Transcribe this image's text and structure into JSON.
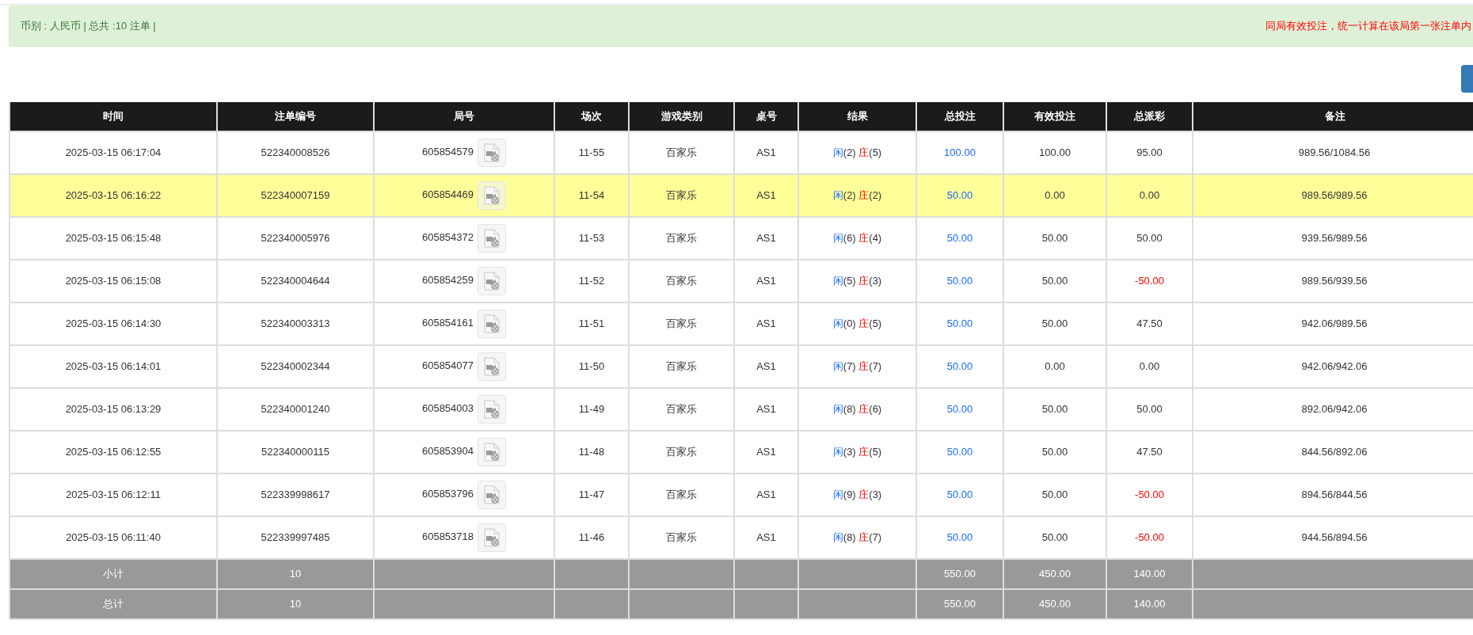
{
  "summary": {
    "text": "币别 : 人民币 | 总共 :10 注单 |",
    "notice": "同局有效投注，统一计算在该局第一张注单内"
  },
  "table": {
    "columns": [
      "时间",
      "注单编号",
      "局号",
      "场次",
      "游戏类别",
      "桌号",
      "结果",
      "总投注",
      "有效投注",
      "总派彩",
      "备注"
    ],
    "rows": [
      {
        "time": "2025-03-15 06:17:04",
        "bet_no": "522340008526",
        "round": "605854579",
        "session": "11-55",
        "game": "百家乐",
        "desk": "AS1",
        "result": {
          "player": "闲",
          "player_points": "(2)",
          "banker": "庄",
          "banker_points": "(5)"
        },
        "total_bet": "100.00",
        "valid_bet": "100.00",
        "payout": "95.00",
        "payout_loss": false,
        "note": "989.56/1084.56",
        "highlighted": false
      },
      {
        "time": "2025-03-15 06:16:22",
        "bet_no": "522340007159",
        "round": "605854469",
        "session": "11-54",
        "game": "百家乐",
        "desk": "AS1",
        "result": {
          "player": "闲",
          "player_points": "(2)",
          "banker": "庄",
          "banker_points": "(2)"
        },
        "total_bet": "50.00",
        "valid_bet": "0.00",
        "payout": "0.00",
        "payout_loss": false,
        "note": "989.56/989.56",
        "highlighted": true
      },
      {
        "time": "2025-03-15 06:15:48",
        "bet_no": "522340005976",
        "round": "605854372",
        "session": "11-53",
        "game": "百家乐",
        "desk": "AS1",
        "result": {
          "player": "闲",
          "player_points": "(6)",
          "banker": "庄",
          "banker_points": "(4)"
        },
        "total_bet": "50.00",
        "valid_bet": "50.00",
        "payout": "50.00",
        "payout_loss": false,
        "note": "939.56/989.56",
        "highlighted": false
      },
      {
        "time": "2025-03-15 06:15:08",
        "bet_no": "522340004644",
        "round": "605854259",
        "session": "11-52",
        "game": "百家乐",
        "desk": "AS1",
        "result": {
          "player": "闲",
          "player_points": "(5)",
          "banker": "庄",
          "banker_points": "(3)"
        },
        "total_bet": "50.00",
        "valid_bet": "50.00",
        "payout": "-50.00",
        "payout_loss": true,
        "note": "989.56/939.56",
        "highlighted": false
      },
      {
        "time": "2025-03-15 06:14:30",
        "bet_no": "522340003313",
        "round": "605854161",
        "session": "11-51",
        "game": "百家乐",
        "desk": "AS1",
        "result": {
          "player": "闲",
          "player_points": "(0)",
          "banker": "庄",
          "banker_points": "(5)"
        },
        "total_bet": "50.00",
        "valid_bet": "50.00",
        "payout": "47.50",
        "payout_loss": false,
        "note": "942.06/989.56",
        "highlighted": false
      },
      {
        "time": "2025-03-15 06:14:01",
        "bet_no": "522340002344",
        "round": "605854077",
        "session": "11-50",
        "game": "百家乐",
        "desk": "AS1",
        "result": {
          "player": "闲",
          "player_points": "(7)",
          "banker": "庄",
          "banker_points": "(7)"
        },
        "total_bet": "50.00",
        "valid_bet": "0.00",
        "payout": "0.00",
        "payout_loss": false,
        "note": "942.06/942.06",
        "highlighted": false
      },
      {
        "time": "2025-03-15 06:13:29",
        "bet_no": "522340001240",
        "round": "605854003",
        "session": "11-49",
        "game": "百家乐",
        "desk": "AS1",
        "result": {
          "player": "闲",
          "player_points": "(8)",
          "banker": "庄",
          "banker_points": "(6)"
        },
        "total_bet": "50.00",
        "valid_bet": "50.00",
        "payout": "50.00",
        "payout_loss": false,
        "note": "892.06/942.06",
        "highlighted": false
      },
      {
        "time": "2025-03-15 06:12:55",
        "bet_no": "522340000115",
        "round": "605853904",
        "session": "11-48",
        "game": "百家乐",
        "desk": "AS1",
        "result": {
          "player": "闲",
          "player_points": "(3)",
          "banker": "庄",
          "banker_points": "(5)"
        },
        "total_bet": "50.00",
        "valid_bet": "50.00",
        "payout": "47.50",
        "payout_loss": false,
        "note": "844.56/892.06",
        "highlighted": false
      },
      {
        "time": "2025-03-15 06:12:11",
        "bet_no": "522339998617",
        "round": "605853796",
        "session": "11-47",
        "game": "百家乐",
        "desk": "AS1",
        "result": {
          "player": "闲",
          "player_points": "(9)",
          "banker": "庄",
          "banker_points": "(3)"
        },
        "total_bet": "50.00",
        "valid_bet": "50.00",
        "payout": "-50.00",
        "payout_loss": true,
        "note": "894.56/844.56",
        "highlighted": false
      },
      {
        "time": "2025-03-15 06:11:40",
        "bet_no": "522339997485",
        "round": "605853718",
        "session": "11-46",
        "game": "百家乐",
        "desk": "AS1",
        "result": {
          "player": "闲",
          "player_points": "(8)",
          "banker": "庄",
          "banker_points": "(7)"
        },
        "total_bet": "50.00",
        "valid_bet": "50.00",
        "payout": "-50.00",
        "payout_loss": true,
        "note": "944.56/894.56",
        "highlighted": false
      }
    ],
    "totals": [
      {
        "label": "小计",
        "count": "10",
        "total_bet": "550.00",
        "valid_bet": "450.00",
        "payout": "140.00"
      },
      {
        "label": "总计",
        "count": "10",
        "total_bet": "550.00",
        "valid_bet": "450.00",
        "payout": "140.00"
      }
    ]
  }
}
